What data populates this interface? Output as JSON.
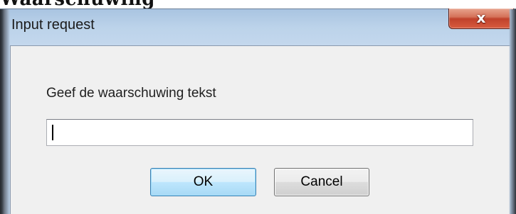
{
  "background_title": "Waarschuwing",
  "dialog": {
    "title": "Input request",
    "close_glyph": "x",
    "prompt": "Geef de waarschuwing tekst",
    "input_value": "",
    "ok_label": "OK",
    "cancel_label": "Cancel"
  },
  "icons": {
    "close": "close-icon"
  },
  "colors": {
    "frame": "#bed2e9",
    "client": "#f0f0f0",
    "close_button": "#c0412b",
    "ok_border": "#3c7fb1"
  }
}
